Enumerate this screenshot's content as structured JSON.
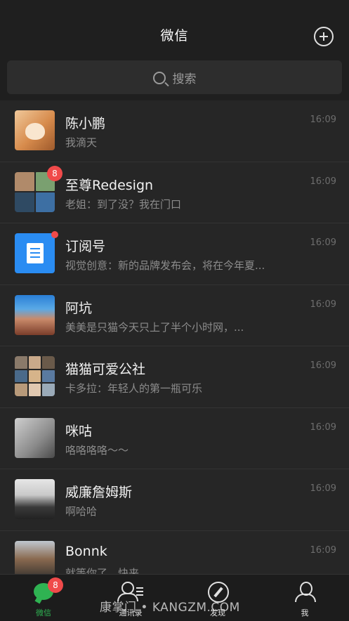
{
  "header": {
    "title": "微信",
    "add_icon": "plus-circle-icon"
  },
  "search": {
    "placeholder": "搜索",
    "icon": "search-icon"
  },
  "chats": [
    {
      "name": "陈小鹏",
      "message": "我滴天",
      "time": "16:09",
      "avatar": "cat-photo"
    },
    {
      "name": "至尊Redesign",
      "message": "老姐：到了没？我在门口",
      "time": "16:09",
      "avatar": "group-4",
      "badge": "8"
    },
    {
      "name": "订阅号",
      "message": "视觉创意：新的品牌发布会，将在今年夏...",
      "time": "16:09",
      "avatar": "subscription-icon",
      "dot": true
    },
    {
      "name": "阿坑",
      "message": "美美是只猫今天只上了半个小时网，...",
      "time": "16:09",
      "avatar": "kid-photo"
    },
    {
      "name": "猫猫可爱公社",
      "message": "卡多拉：年轻人的第一瓶可乐",
      "time": "16:09",
      "avatar": "group-9"
    },
    {
      "name": "咪咕",
      "message": "咯咯咯咯～～",
      "time": "16:09",
      "avatar": "man-photo"
    },
    {
      "name": "威廉詹姆斯",
      "message": "啊哈哈",
      "time": "16:09",
      "avatar": "girl-photo"
    },
    {
      "name": "Bonnk",
      "message": "就等你了，快来。",
      "time": "16:09",
      "avatar": "man-photo-2"
    }
  ],
  "tabs": [
    {
      "label": "微信",
      "icon": "chat-icon",
      "active": true,
      "badge": "8"
    },
    {
      "label": "通讯录",
      "icon": "contacts-icon"
    },
    {
      "label": "发现",
      "icon": "compass-icon"
    },
    {
      "label": "我",
      "icon": "person-icon"
    }
  ],
  "watermark": "康掌门 • KANGZM.COM",
  "colors": {
    "accent": "#2fb352",
    "badge": "#f04a4a",
    "background": "#1f1f1f"
  }
}
